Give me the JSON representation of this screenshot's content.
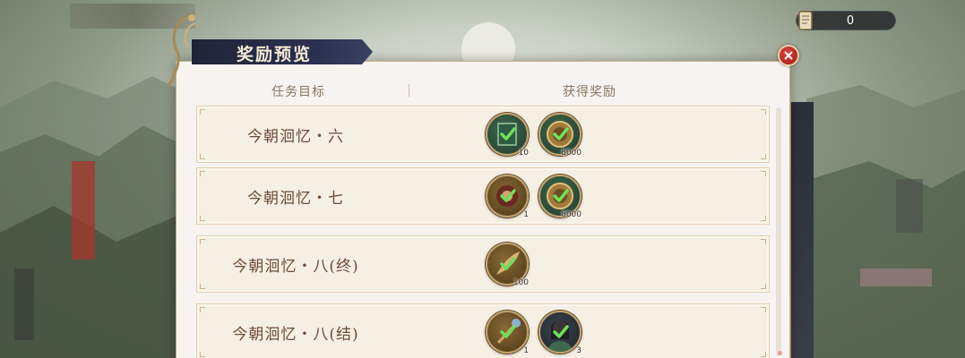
{
  "top_banner": {
    "text": ""
  },
  "currency": {
    "icon": "scroll-icon",
    "amount": "0"
  },
  "dialog": {
    "title": "奖励预览",
    "close_icon": "close-icon",
    "columns": {
      "task": "任务目标",
      "reward": "获得奖励"
    }
  },
  "rows": [
    {
      "task": "今朝洄忆・六",
      "rewards": [
        {
          "icon": "book-icon",
          "qty": "10",
          "claimed": true,
          "style": "green"
        },
        {
          "icon": "coin-icon",
          "qty": "8000",
          "claimed": true,
          "style": "green"
        }
      ]
    },
    {
      "task": "今朝洄忆・七",
      "rewards": [
        {
          "icon": "flower-icon",
          "qty": "1",
          "claimed": true,
          "style": "brown"
        },
        {
          "icon": "coin-icon",
          "qty": "8000",
          "claimed": true,
          "style": "green"
        }
      ]
    },
    {
      "task": "今朝洄忆・八(终)",
      "rewards": [
        {
          "icon": "feather-icon",
          "qty": "100",
          "claimed": true,
          "style": "brown"
        }
      ]
    },
    {
      "task": "今朝洄忆・八(结)",
      "rewards": [
        {
          "icon": "hairpin-icon",
          "qty": "1",
          "claimed": true,
          "style": "brown"
        },
        {
          "icon": "character-portrait-icon",
          "qty": "3",
          "claimed": true,
          "style": "dark"
        }
      ]
    }
  ],
  "colors": {
    "panel_bg": "#f7f3f1",
    "row_bg": "#f6efe3",
    "title_tab": "#1f2438",
    "task_text": "#6b4a36",
    "check": "#6fe05a",
    "close_button": "#c0302a"
  }
}
